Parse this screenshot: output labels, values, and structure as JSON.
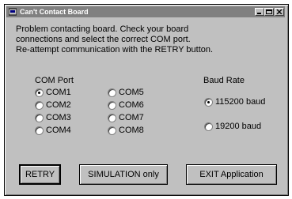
{
  "window": {
    "title": "Can't Contact Board"
  },
  "message": {
    "line1": "Problem contacting board.  Check your board",
    "line2": "connections and select the correct COM port.",
    "line3": "Re-attempt communication with the RETRY button."
  },
  "com_port": {
    "label": "COM Port",
    "options": [
      "COM1",
      "COM2",
      "COM3",
      "COM4",
      "COM5",
      "COM6",
      "COM7",
      "COM8"
    ],
    "selected": "COM1"
  },
  "baud_rate": {
    "label": "Baud Rate",
    "options": [
      "115200 baud",
      "19200 baud"
    ],
    "selected": "115200 baud"
  },
  "buttons": {
    "retry": "RETRY",
    "simulation": "SIMULATION only",
    "exit": "EXIT Application"
  },
  "icons": {
    "app": "app-icon",
    "minimize": "minimize-icon",
    "maximize": "maximize-icon",
    "close": "close-icon"
  }
}
